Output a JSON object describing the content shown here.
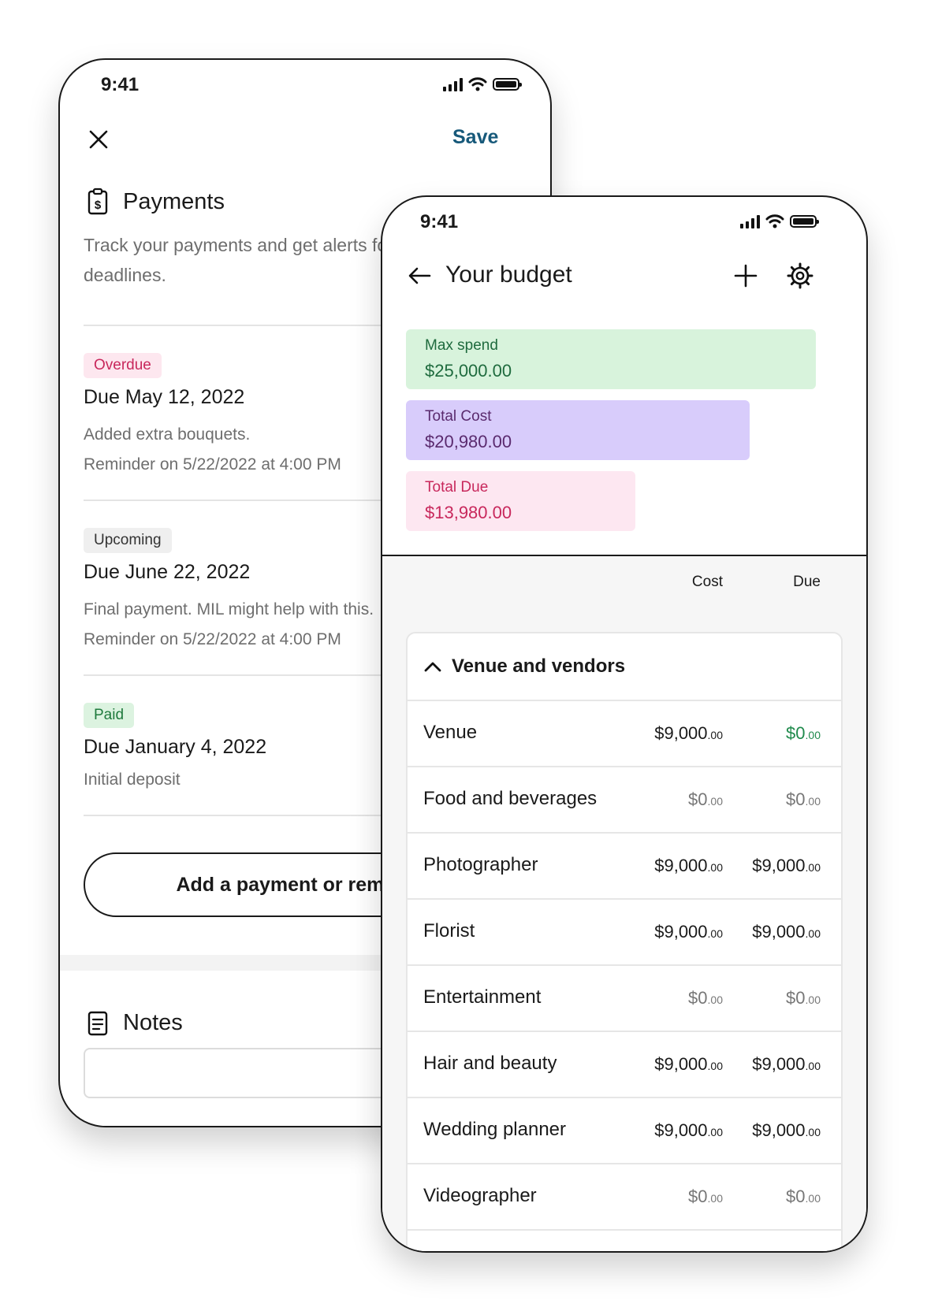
{
  "payments_screen": {
    "status_time": "9:41",
    "close_label": "×",
    "save_label": "Save",
    "section_title": "Payments",
    "section_icon": "receipt-dollar-icon",
    "description_line1": "Track your payments and get alerts for",
    "description_line2": "deadlines.",
    "payments": [
      {
        "badge": "Overdue",
        "badge_bg": "#fde7ef",
        "badge_color": "#c8285c",
        "due": "Due May 12, 2022",
        "note": "Added extra bouquets.",
        "reminder": "Reminder on 5/22/2022 at 4:00 PM"
      },
      {
        "badge": "Upcoming",
        "badge_bg": "#efefef",
        "badge_color": "#333333",
        "due": "Due June 22, 2022",
        "note": "Final payment. MIL might help with this.",
        "reminder": "Reminder on 5/22/2022 at 4:00 PM"
      },
      {
        "badge": "Paid",
        "badge_bg": "#dcf3e0",
        "badge_color": "#1f7a3d",
        "due": "Due January 4, 2022",
        "note": "Initial deposit",
        "reminder": ""
      }
    ],
    "add_button_label": "Add a payment or reminder",
    "notes_title": "Notes",
    "notes_icon": "document-icon"
  },
  "budget_screen": {
    "status_time": "9:41",
    "back_icon": "arrow-left-icon",
    "title": "Your budget",
    "add_icon": "plus-icon",
    "settings_icon": "gear-icon",
    "summary": [
      {
        "label": "Max spend",
        "value": "$25,000.00",
        "bg": "#d8f3dc",
        "color": "#1f6b3e",
        "share": 1.0
      },
      {
        "label": "Total Cost",
        "value": "$20,980.00",
        "bg": "#d8ccfb",
        "color": "#5a2a6e",
        "share": 0.8392
      },
      {
        "label": "Total Due",
        "value": "$13,980.00",
        "bg": "#fde7f1",
        "color": "#c8285c",
        "share": 0.5592
      }
    ],
    "col_cost": "Cost",
    "col_due": "Due",
    "group_title": "Venue and vendors",
    "group_icon": "chevron-up-icon",
    "rows": [
      {
        "name": "Venue",
        "cost": "$9,000",
        "cost_cents": ".00",
        "due": "$0",
        "due_cents": ".00",
        "cost_muted": false,
        "due_green": true
      },
      {
        "name": "Food and beverages",
        "cost": "$0",
        "cost_cents": ".00",
        "due": "$0",
        "due_cents": ".00",
        "cost_muted": true,
        "due_green": false
      },
      {
        "name": "Photographer",
        "cost": "$9,000",
        "cost_cents": ".00",
        "due": "$9,000",
        "due_cents": ".00",
        "cost_muted": false,
        "due_green": false
      },
      {
        "name": "Florist",
        "cost": "$9,000",
        "cost_cents": ".00",
        "due": "$9,000",
        "due_cents": ".00",
        "cost_muted": false,
        "due_green": false
      },
      {
        "name": "Entertainment",
        "cost": "$0",
        "cost_cents": ".00",
        "due": "$0",
        "due_cents": ".00",
        "cost_muted": true,
        "due_green": false
      },
      {
        "name": "Hair and beauty",
        "cost": "$9,000",
        "cost_cents": ".00",
        "due": "$9,000",
        "due_cents": ".00",
        "cost_muted": false,
        "due_green": false
      },
      {
        "name": "Wedding planner",
        "cost": "$9,000",
        "cost_cents": ".00",
        "due": "$9,000",
        "due_cents": ".00",
        "cost_muted": false,
        "due_green": false
      },
      {
        "name": "Videographer",
        "cost": "$0",
        "cost_cents": ".00",
        "due": "$0",
        "due_cents": ".00",
        "cost_muted": true,
        "due_green": false
      }
    ]
  },
  "colors": {
    "accent": "#17597a",
    "green": "#1f8a4c"
  }
}
